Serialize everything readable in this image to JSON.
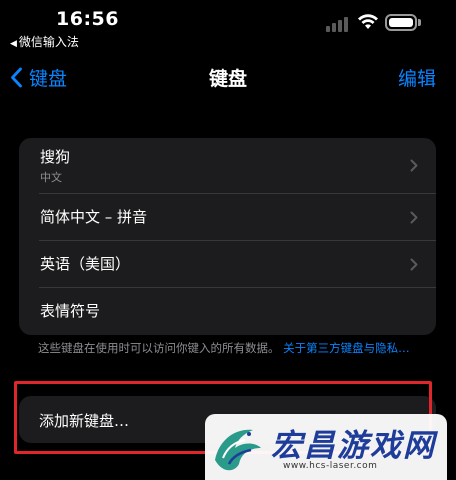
{
  "status_bar": {
    "time": "16:56",
    "back_app": "微信输入法"
  },
  "nav": {
    "back_label": "键盘",
    "title": "键盘",
    "edit_label": "编辑"
  },
  "keyboards": [
    {
      "title": "搜狗",
      "subtitle": "中文"
    },
    {
      "title": "简体中文 – 拼音"
    },
    {
      "title": "英语（美国）"
    },
    {
      "title": "表情符号"
    }
  ],
  "footer": {
    "note": "这些键盘在使用时可以访问你键入的所有数据。",
    "link": "关于第三方键盘与隐私…"
  },
  "add_keyboard": {
    "label": "添加新键盘…"
  },
  "watermark": {
    "brand": "宏昌游戏网",
    "url": "www.hcs-laser.com"
  },
  "colors": {
    "accent": "#0a84ff",
    "highlight": "#e0262a"
  }
}
